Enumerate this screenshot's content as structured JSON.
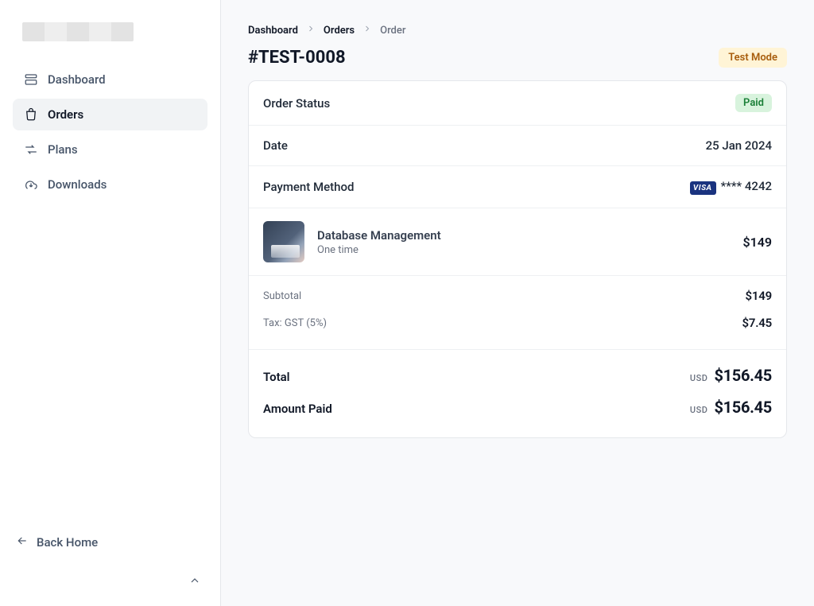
{
  "sidebar": {
    "items": [
      {
        "label": "Dashboard",
        "icon": "dashboard-icon",
        "active": false
      },
      {
        "label": "Orders",
        "icon": "orders-icon",
        "active": true
      },
      {
        "label": "Plans",
        "icon": "plans-icon",
        "active": false
      },
      {
        "label": "Downloads",
        "icon": "downloads-icon",
        "active": false
      }
    ],
    "back_home_label": "Back Home"
  },
  "breadcrumb": {
    "items": [
      "Dashboard",
      "Orders",
      "Order"
    ]
  },
  "header": {
    "page_title": "#TEST-0008",
    "test_mode_label": "Test Mode"
  },
  "order": {
    "status_label": "Order Status",
    "status_value": "Paid",
    "date_label": "Date",
    "date_value": "25 Jan 2024",
    "payment_method_label": "Payment Method",
    "card_brand": "VISA",
    "card_masked": "**** 4242",
    "product": {
      "name": "Database Management",
      "billing": "One time",
      "price": "$149"
    },
    "subtotal_label": "Subtotal",
    "subtotal_value": "$149",
    "tax_label": "Tax: GST (5%)",
    "tax_value": "$7.45",
    "total_label": "Total",
    "amount_paid_label": "Amount Paid",
    "currency": "USD",
    "total_value": "$156.45",
    "amount_paid_value": "$156.45"
  },
  "colors": {
    "accent_bg": "#f8f9fb",
    "status_bg": "#d8f3dd",
    "status_fg": "#1a7f37",
    "test_mode_bg": "#fff4d6",
    "test_mode_fg": "#a75c0b",
    "visa_bg": "#1a337f"
  }
}
